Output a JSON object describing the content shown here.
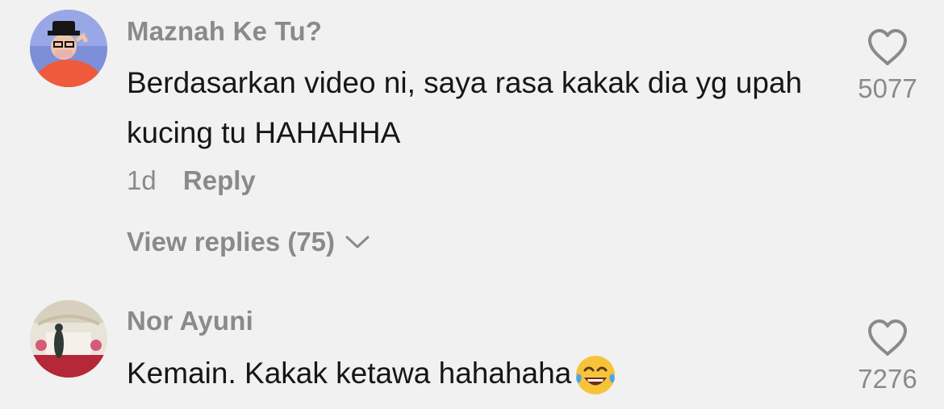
{
  "comments": [
    {
      "username": "Maznah Ke Tu?",
      "text": "Berdasarkan video ni, saya rasa kakak dia yg upah kucing tu HAHAHHA",
      "time": "1d",
      "reply_label": "Reply",
      "view_replies": "View replies (75)",
      "likes": "5077",
      "avatar_icon": "avatar-man-hat-glasses"
    },
    {
      "username": "Nor Ayuni",
      "text": "Kemain. Kakak ketawa hahahaha",
      "likes": "7276",
      "avatar_icon": "avatar-wedding-dais",
      "emoji": "face-with-tears-of-joy"
    }
  ],
  "colors": {
    "background": "#f1f1f1",
    "muted_text": "#8a8a8a",
    "primary_text": "#161616"
  }
}
